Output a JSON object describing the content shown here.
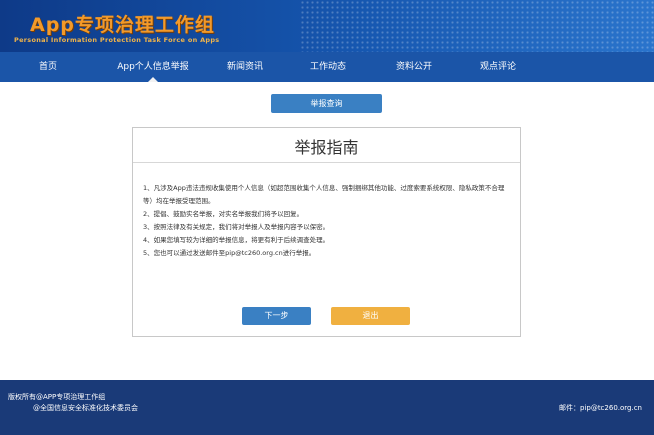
{
  "header": {
    "logo_title": "App专项治理工作组",
    "logo_subtitle": "Personal Information Protection Task Force on Apps"
  },
  "nav": {
    "items": [
      {
        "label": "首页"
      },
      {
        "label": "App个人信息举报"
      },
      {
        "label": "新闻资讯"
      },
      {
        "label": "工作动态"
      },
      {
        "label": "资料公开"
      },
      {
        "label": "观点评论"
      }
    ],
    "active_index": 1
  },
  "query_button": "举报查询",
  "dialog": {
    "title": "举报指南",
    "items": [
      "1、凡涉及App违法违规收集使用个人信息（如超范围收集个人信息、强制捆绑其他功能、过度索要系统权限、隐私政策不合理等）均在举报受理范围。",
      "2、提倡、鼓励实名举报，对实名举报我们将予以回复。",
      "3、按照法律及有关规定，我们将对举报人及举报内容予以保密。",
      "4、如果您填写较为详细的举报信息，将更有利于后续调查处理。",
      "5、您也可以通过发送邮件至pip@tc260.org.cn进行举报。"
    ],
    "next_label": "下一步",
    "exit_label": "退出"
  },
  "footer": {
    "copyright": "版权所有@APP专项治理工作组",
    "org": "@全国信息安全标准化技术委员会",
    "email": "邮件：pip@tc260.org.cn"
  }
}
